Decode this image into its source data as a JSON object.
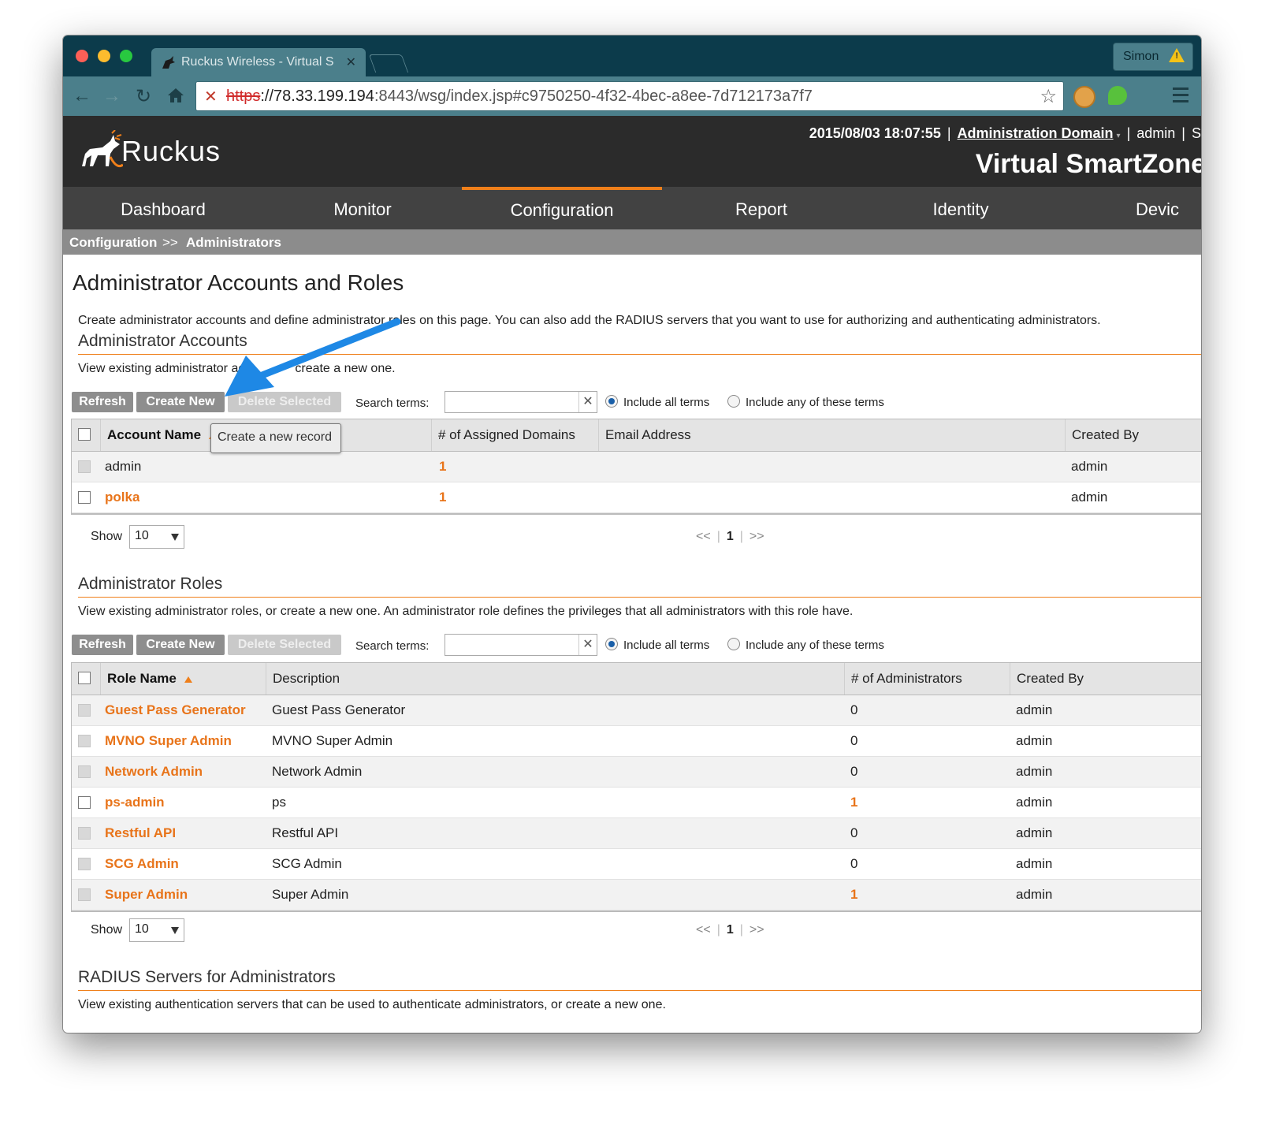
{
  "browser": {
    "tab_title": "Ruckus Wireless - Virtual S",
    "profile_name": "Simon",
    "url_scheme": "https",
    "url_host": "://78.33.199.194",
    "url_rest": ":8443/wsg/index.jsp#c9750250-4f32-4bec-a8ee-7d712173a7f7"
  },
  "header": {
    "logo_text": "Ruckus",
    "datetime": "2015/08/03 18:07:55",
    "domain_link": "Administration Domain",
    "user": "admin",
    "cut_item": "S",
    "product": "Virtual SmartZone"
  },
  "nav": [
    {
      "label": "Dashboard"
    },
    {
      "label": "Monitor"
    },
    {
      "label": "Configuration"
    },
    {
      "label": "Report"
    },
    {
      "label": "Identity"
    },
    {
      "label": "Devic"
    }
  ],
  "breadcrumb": {
    "root": "Configuration",
    "sep": ">>",
    "current": "Administrators"
  },
  "page": {
    "title": "Administrator Accounts and Roles",
    "intro": "Create administrator accounts and define administrator roles on this page. You can also add the RADIUS servers that you want to use for authorizing and authenticating administrators."
  },
  "toolbar_labels": {
    "refresh": "Refresh",
    "create": "Create New",
    "delete": "Delete Selected",
    "search": "Search terms:",
    "all_terms": "Include all terms",
    "any_terms": "Include any of these terms",
    "show": "Show",
    "page_size": "10",
    "prev": "<<",
    "page": "1",
    "next": ">>"
  },
  "accounts": {
    "title": "Administrator Accounts",
    "desc_left": "View existing administrator ac",
    "desc_right": "create a new one.",
    "tooltip": "Create a new record",
    "columns": [
      "Account Name",
      "# of Assigned Domains",
      "Email Address",
      "Created By"
    ],
    "rows": [
      {
        "name": "admin",
        "domains": "1",
        "email": "",
        "created_by": "admin"
      },
      {
        "name": "polka",
        "domains": "1",
        "email": "",
        "created_by": "admin"
      }
    ]
  },
  "roles": {
    "title": "Administrator Roles",
    "desc": "View existing administrator roles, or create a new one. An administrator role defines the privileges that all administrators with this role have.",
    "columns": [
      "Role Name",
      "Description",
      "# of Administrators",
      "Created By"
    ],
    "rows": [
      {
        "name": "Guest Pass Generator",
        "desc": "Guest Pass Generator",
        "count": "0",
        "created_by": "admin"
      },
      {
        "name": "MVNO Super Admin",
        "desc": "MVNO Super Admin",
        "count": "0",
        "created_by": "admin"
      },
      {
        "name": "Network Admin",
        "desc": "Network Admin",
        "count": "0",
        "created_by": "admin"
      },
      {
        "name": "ps-admin",
        "desc": "ps",
        "count": "1",
        "created_by": "admin"
      },
      {
        "name": "Restful API",
        "desc": "Restful API",
        "count": "0",
        "created_by": "admin"
      },
      {
        "name": "SCG Admin",
        "desc": "SCG Admin",
        "count": "0",
        "created_by": "admin"
      },
      {
        "name": "Super Admin",
        "desc": "Super Admin",
        "count": "1",
        "created_by": "admin"
      }
    ]
  },
  "radius": {
    "title": "RADIUS Servers for Administrators",
    "desc": "View existing authentication servers that can be used to authenticate administrators, or create a new one."
  },
  "colors": {
    "accent": "#ef7f1a",
    "header_bg": "#2b2b2b",
    "nav_bg": "#424242",
    "chrome_bg": "#0c3b4b",
    "arrow": "#1e88e5"
  }
}
